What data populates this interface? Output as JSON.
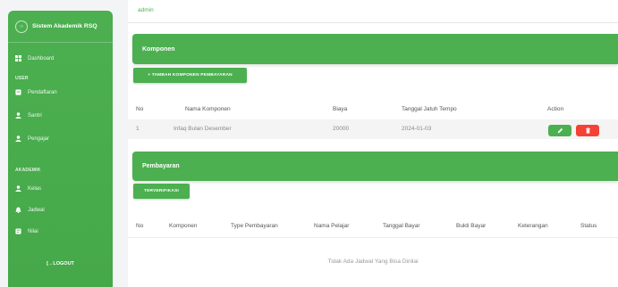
{
  "sidebar": {
    "brand": "Sistem Akademik RSQ",
    "dashboard": "Dashboard",
    "section_user": "USER",
    "pendaftaran": "Pendaftaran",
    "santri": "Santri",
    "pengajar": "Pengajar",
    "section_akademik": "AKADEMIK",
    "kelas": "Kelas",
    "jadwal": "Jadwal",
    "nilai": "Nilai",
    "logout": "[→LOGOUT"
  },
  "topbar": {
    "user": "admin"
  },
  "komponen": {
    "title": "Komponen",
    "add_button": "+ TAMBAH KOMPONEN PEMBAYARAN",
    "columns": [
      "No",
      "Nama Komponen",
      "Biaya",
      "Tanggal Jatuh Tempo",
      "Action"
    ],
    "rows": [
      {
        "no": "1",
        "nama": "Infaq Bulan Desember",
        "biaya": "20000",
        "tanggal": "2024-01-03"
      }
    ]
  },
  "pembayaran": {
    "title": "Pembayaran",
    "filter_button": "TERVERIFIKASI",
    "columns": [
      "No",
      "Komponen",
      "Type Pembayaran",
      "Nama Pelajar",
      "Tanggal Bayar",
      "Bukti Bayar",
      "Keterangan",
      "Status"
    ],
    "empty_text": "Tidak Ada Jadwal Yang Bisa Dinilai"
  },
  "colors": {
    "primary": "#4caf50",
    "danger": "#f44336"
  }
}
